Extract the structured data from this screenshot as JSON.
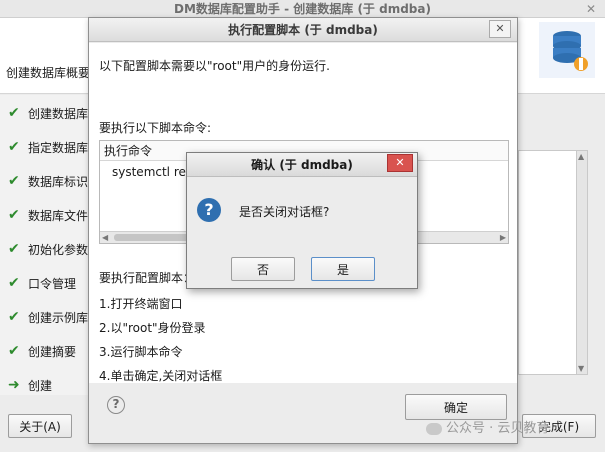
{
  "main_window": {
    "title": "DM数据库配置助手 - 创建数据库 (于 dmdba)",
    "close_glyph": "✕",
    "header_label": "创建数据库概要",
    "steps": [
      {
        "label": "创建数据库"
      },
      {
        "label": "指定数据库"
      },
      {
        "label": "数据库标识"
      },
      {
        "label": "数据库文件"
      },
      {
        "label": "初始化参数"
      },
      {
        "label": "口令管理"
      },
      {
        "label": "创建示例库"
      },
      {
        "label": "创建摘要"
      },
      {
        "label": "创建"
      }
    ],
    "footer": {
      "about_button": "关于(A)",
      "finish_button": "完成(F)"
    },
    "watermark": "公众号 · 云贝教育"
  },
  "exec_dialog": {
    "title": "执行配置脚本 (于 dmdba)",
    "close_glyph": "✕",
    "intro_text": "以下配置脚本需要以\"root\"用户的身份运行.",
    "commands_label": "要执行以下脚本命令:",
    "table_header": "执行命令",
    "commands": [
      "systemctl restart DmServiceDMSERVER.service"
    ],
    "steps_label": "要执行配置脚本：",
    "steps": [
      "1.打开终端窗口",
      "2.以\"root\"身份登录",
      "3.运行脚本命令",
      "4.单击确定,关闭对话框"
    ],
    "ok_button": "确定"
  },
  "confirm_dialog": {
    "title": "确认    (于 dmdba)",
    "close_glyph": "✕",
    "message": "是否关闭对话框?",
    "no_button": "否",
    "yes_button": "是"
  },
  "colors": {
    "check": "#2e8b2e",
    "question_icon": "#2f6fb0",
    "confirm_close": "#d9534f"
  }
}
